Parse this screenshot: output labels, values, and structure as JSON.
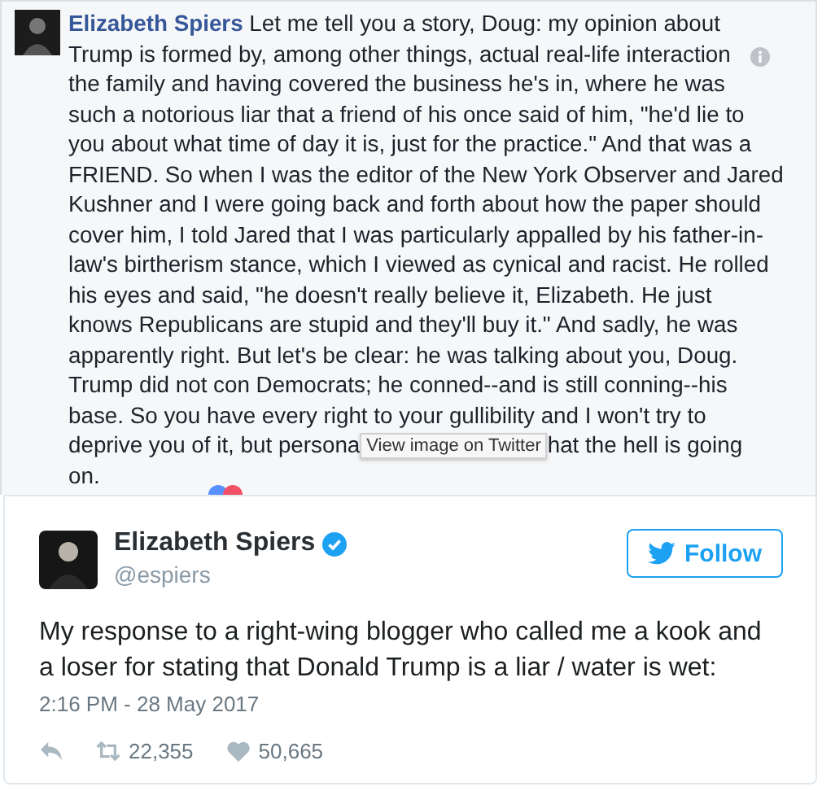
{
  "comment": {
    "author": "Elizabeth Spiers",
    "lines": [
      "Let me tell you a story, Doug: my opinion about",
      "Trump is formed by, among other things, actual real-life interaction",
      "the family and having covered the business he's in, where he was",
      "such a notorious liar that a friend of his once said of him, \"he'd lie to",
      "you about what time of day it is, just for the practice.\" And that was a",
      "FRIEND. So when I was the editor of the New York Observer and Jared",
      "Kushner and I were going back and forth about how the paper should",
      "cover him, I told Jared that I was particularly appalled by his father-in-",
      "law's birtherism stance, which I viewed as cynical and racist. He rolled",
      "his eyes and said, \"he doesn't really believe it, Elizabeth. He just",
      "knows Republicans are stupid and they'll buy it.\" And sadly, he was",
      "apparently right. But let's be clear: he was talking about you, Doug.",
      "Trump did not con Democrats; he conned--and is still conning--his",
      "base. So you have every right to your gullibility and I won't try to"
    ],
    "covered_line": {
      "before": "deprive you of it, but persona",
      "after": "hat the hell is going"
    },
    "last_line": "on.",
    "tooltip": "View image on Twitter"
  },
  "tweet": {
    "name": "Elizabeth Spiers",
    "verified": true,
    "handle": "@espiers",
    "follow_button": "Follow",
    "text": "My response to a right-wing blogger who called me a kook and a loser for stating that Donald Trump is a liar / water is wet:",
    "time": "2:16 PM - 28 May 2017",
    "actions": [
      {
        "kind": "reply"
      },
      {
        "kind": "retweet",
        "count": "22,355"
      },
      {
        "kind": "like",
        "count": "50,665"
      }
    ]
  }
}
